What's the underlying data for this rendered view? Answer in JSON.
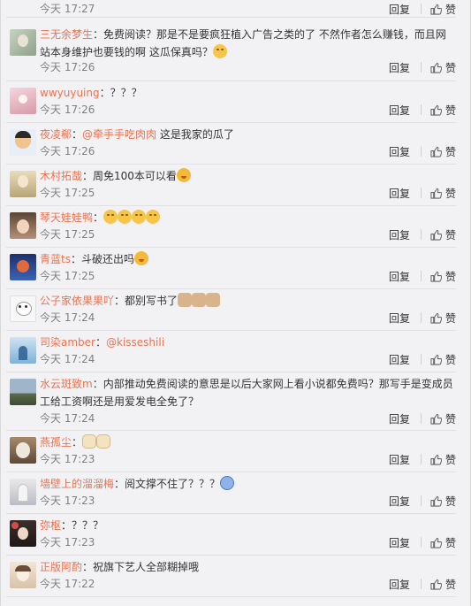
{
  "actions": {
    "reply_label": "回复",
    "like_label": "赞"
  },
  "comments": [
    {
      "time": "今天 17:27"
    },
    {
      "username": "三无余梦生",
      "sep": "：",
      "text1": "免费阅读？那是不是要疯狂植入广告之类的了 不然作者怎么赚钱，而且网站本身维护也要钱的啊 这瓜保真吗？",
      "time": "今天 17:26",
      "emoji": "smile"
    },
    {
      "username": "wwyuyuing",
      "sep": "：",
      "text1": "？？？",
      "time": "今天 17:26"
    },
    {
      "username": "夜凌郗",
      "sep": "：",
      "mention": "@牵手手吃肉肉",
      "text1": " 这是我家的瓜了",
      "time": "今天 17:26"
    },
    {
      "username": "木村拓哉",
      "sep": "：",
      "text1": "周免100本可以看",
      "time": "今天 17:25",
      "emoji": "face"
    },
    {
      "username": "琴天娃娃鸭",
      "sep": "：",
      "text1": "",
      "time": "今天 17:25",
      "emoji": "smile-x4"
    },
    {
      "username": "青蓝ts",
      "sep": "：",
      "text1": "斗破还出吗",
      "time": "今天 17:25",
      "emoji": "face"
    },
    {
      "username": "公子家依果果吖",
      "sep": "：",
      "text1": "都别写书了",
      "time": "今天 17:24",
      "emoji": "cat-x3"
    },
    {
      "username": "司染amber",
      "sep": "：",
      "mention": "@kisseshili",
      "text1": "",
      "time": "今天 17:24"
    },
    {
      "username": "水云斑致m",
      "sep": "：",
      "text1": "内部推动免费阅读的意思是以后大家网上看小说都免费吗？那写手是变成员工给工资啊还是用爱发电全免了？",
      "time": "今天 17:24"
    },
    {
      "username": "燕孤尘",
      "sep": "：",
      "text1": "",
      "time": "今天 17:23",
      "emoji": "dog-x2"
    },
    {
      "username": "墙壁上的溜溜梅",
      "sep": "：",
      "text1": "阅文撑不住了？？？",
      "time": "今天 17:23",
      "emoji": "cry"
    },
    {
      "username": "弥枢",
      "sep": "：",
      "text1": "？？？",
      "time": "今天 17:23"
    },
    {
      "username": "正版阿酌",
      "sep": "：",
      "text1": "祝旗下艺人全部糊掉哦",
      "time": "今天 17:22"
    }
  ]
}
